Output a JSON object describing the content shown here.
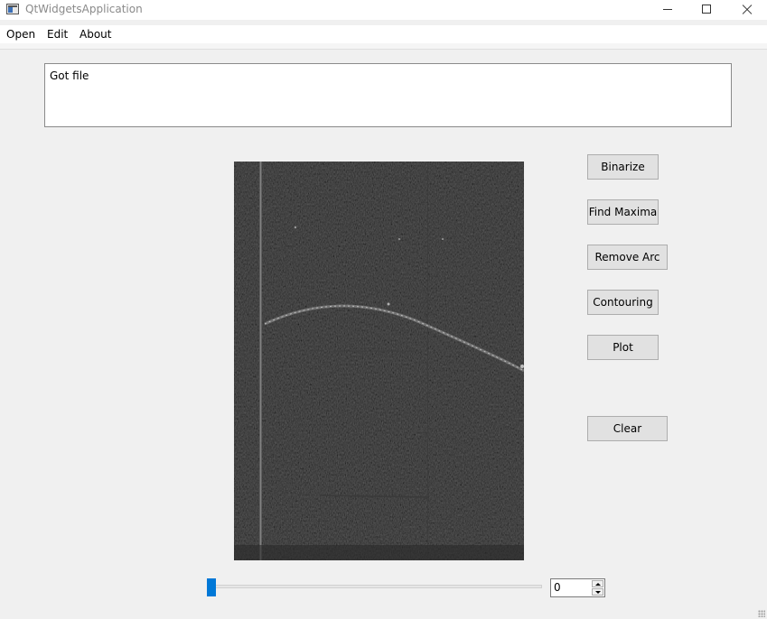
{
  "window": {
    "title": "QtWidgetsApplication"
  },
  "menu": [
    {
      "label": "Open"
    },
    {
      "label": "Edit"
    },
    {
      "label": "About"
    }
  ],
  "log": {
    "text": "Got file"
  },
  "buttons": {
    "binarize": "Binarize",
    "find_maxima": "Find Maxima",
    "remove_arc": "Remove Arc",
    "contouring": "Contouring",
    "plot": "Plot",
    "clear": "Clear"
  },
  "slider": {
    "value": 0,
    "accent": "#0078d7"
  },
  "spinbox": {
    "value": "0"
  },
  "icons": {
    "app": "app-window-icon",
    "minimize": "minimize-icon",
    "maximize": "maximize-icon",
    "close": "close-icon",
    "spin_up": "arrow-up-icon",
    "spin_down": "arrow-down-icon"
  }
}
